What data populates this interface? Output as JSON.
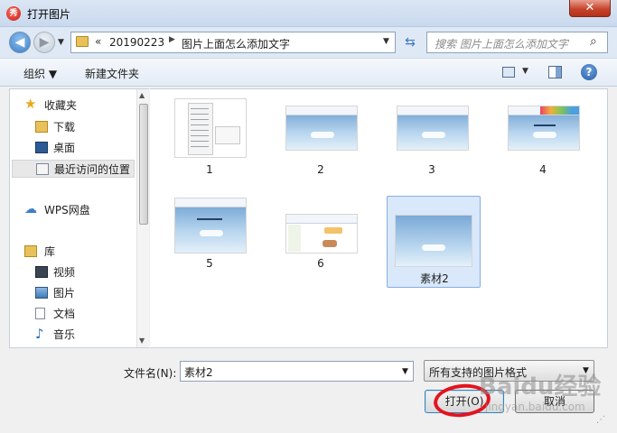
{
  "window": {
    "title": "打开图片",
    "app_icon_text": "秀",
    "close_symbol": "✕"
  },
  "nav": {
    "address": {
      "chevron": "«",
      "crumbs": [
        "20190223",
        "图片上面怎么添加文字"
      ],
      "separator": "▶"
    },
    "search_placeholder": "搜索 图片上面怎么添加文字",
    "icons": {
      "back": "◀",
      "forward": "▶",
      "dropdown": "▼",
      "refresh": "⇆",
      "search": "⌕"
    }
  },
  "toolbar": {
    "organize": "组织 ▼",
    "new_folder": "新建文件夹",
    "view_dropdown": "▼",
    "help": "?"
  },
  "sidebar": {
    "items": [
      {
        "label": "收藏夹",
        "icon": "star-icon"
      },
      {
        "label": "下载",
        "icon": "download-folder-icon"
      },
      {
        "label": "桌面",
        "icon": "desktop-icon"
      },
      {
        "label": "最近访问的位置",
        "icon": "recent-places-icon",
        "selected": true
      },
      {
        "label": "WPS网盘",
        "icon": "cloud-icon"
      },
      {
        "label": "库",
        "icon": "library-icon"
      },
      {
        "label": "视频",
        "icon": "video-icon"
      },
      {
        "label": "图片",
        "icon": "picture-icon"
      },
      {
        "label": "文档",
        "icon": "document-icon"
      },
      {
        "label": "音乐",
        "icon": "music-icon"
      }
    ],
    "scroll_up": "▲",
    "scroll_down": "▼"
  },
  "files": [
    {
      "name": "1",
      "kind": "menu"
    },
    {
      "name": "2",
      "kind": "paint"
    },
    {
      "name": "3",
      "kind": "paint"
    },
    {
      "name": "4",
      "kind": "paint-text"
    },
    {
      "name": "5",
      "kind": "paint-text"
    },
    {
      "name": "6",
      "kind": "web"
    },
    {
      "name": "素材2",
      "kind": "sky",
      "selected": true
    }
  ],
  "bottom": {
    "filename_label": "文件名(N):",
    "filename_value": "素材2",
    "filetype_value": "所有支持的图片格式",
    "open_label": "打开(O)",
    "cancel_label": "取消",
    "dropdown": "▼"
  },
  "watermark": {
    "brand": "Baidu经验",
    "url": "jingyan.baidu.com"
  },
  "colors": {
    "accent": "#3c7fc7",
    "annotation_red": "#e4131e",
    "selection": "#d9e8fb"
  }
}
